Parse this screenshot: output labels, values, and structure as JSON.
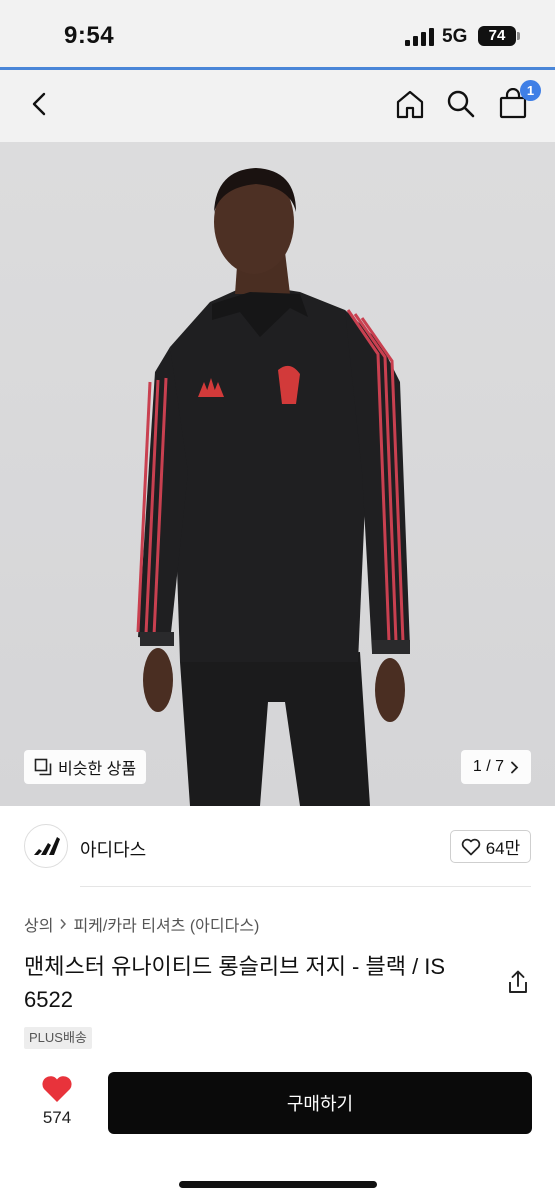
{
  "status_bar": {
    "time": "9:54",
    "network": "5G",
    "battery": "74"
  },
  "nav": {
    "cart_count": "1"
  },
  "hero": {
    "similar_label": "비슷한 상품",
    "page_indicator": "1 / 7"
  },
  "seller": {
    "name": "아디다스",
    "likes": "64만"
  },
  "breadcrumb": {
    "category": "상의",
    "subcategory": "피케/카라 티셔츠 (아디다스)"
  },
  "product": {
    "title": "맨체스터 유나이티드 롱슬리브 저지 - 블랙 / IS 6522",
    "shipping_badge": "PLUS배송"
  },
  "bottom_bar": {
    "heart_count": "574",
    "buy_label": "구매하기"
  },
  "colors": {
    "accent_blue": "#3f7fe6",
    "heart_red": "#e8333b",
    "buy_button": "#0a0a0a"
  },
  "icons": [
    "signal-icon",
    "battery-icon",
    "back-icon",
    "home-icon",
    "search-icon",
    "cart-icon",
    "similar-items-icon",
    "chevron-right-icon",
    "adidas-logo",
    "heart-outline-icon",
    "share-icon",
    "heart-filled-icon"
  ]
}
